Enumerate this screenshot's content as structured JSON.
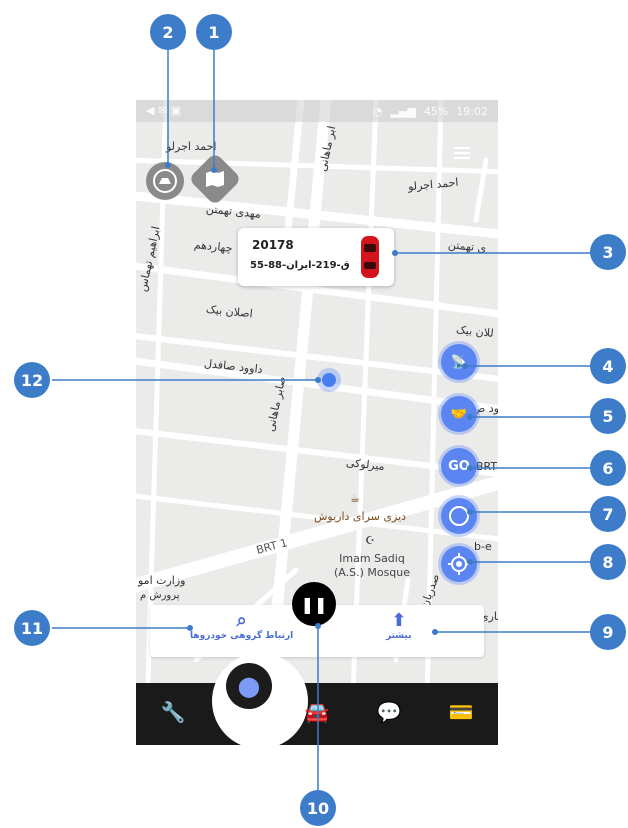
{
  "status_bar": {
    "battery": "45%",
    "time": "19:02"
  },
  "map": {
    "road_labels": [
      {
        "id": "ahmad-ajorlou-top",
        "text": "احمد اجرلو"
      },
      {
        "id": "ahmad-ajorlou-right",
        "text": "احمد اجرلو"
      },
      {
        "id": "mahdi-tahmtan",
        "text": "مهدی تهمتن"
      },
      {
        "id": "chahardahom",
        "text": "چهاردهم"
      },
      {
        "id": "tahmtan-right",
        "text": "ی تهمتن"
      },
      {
        "id": "aslan-beyk",
        "text": "اصلان بیک"
      },
      {
        "id": "aslan-beyk-right",
        "text": "للان بیک"
      },
      {
        "id": "davood-safedel",
        "text": "داوود صافدل"
      },
      {
        "id": "saber-mahani",
        "text": "صابر ماهانی"
      },
      {
        "id": "saber-mahani-top",
        "text": "ابر ماهانی"
      },
      {
        "id": "ebrahim-tahmasbi",
        "text": "ابراهیم تهماس"
      },
      {
        "id": "mirlouki",
        "text": "میرلوکی"
      },
      {
        "id": "brt1",
        "text": "BRT 1"
      },
      {
        "id": "sadrian",
        "text": "صدریان"
      },
      {
        "id": "davood-right",
        "text": "ود ص"
      },
      {
        "id": "vezarat",
        "text": "وزارت امو"
      },
      {
        "id": "parvaresh",
        "text": "پرورش م"
      },
      {
        "id": "brt-right",
        "text": "BRT"
      },
      {
        "id": "b-e",
        "text": "b-e"
      },
      {
        "id": "tari",
        "text": "ناری"
      }
    ],
    "pois": {
      "restaurant": "دیزی سرای داریوش",
      "mosque_line1": "Imam Sadiq",
      "mosque_line2": "(A.S.) Mosque"
    }
  },
  "vehicle_card": {
    "number": "20178",
    "plate": "55-ق-219-ایران-88"
  },
  "fab_go_label": "GO",
  "bottom_panel": {
    "search_label": "ارتباط گروهی خودروها",
    "more_label": "بیشتر"
  },
  "callouts": [
    "1",
    "2",
    "3",
    "4",
    "5",
    "6",
    "7",
    "8",
    "9",
    "10",
    "11",
    "12"
  ],
  "colors": {
    "accent": "#5b86f2",
    "callout": "#3d7cc9",
    "navbar": "#1a1a1a"
  }
}
